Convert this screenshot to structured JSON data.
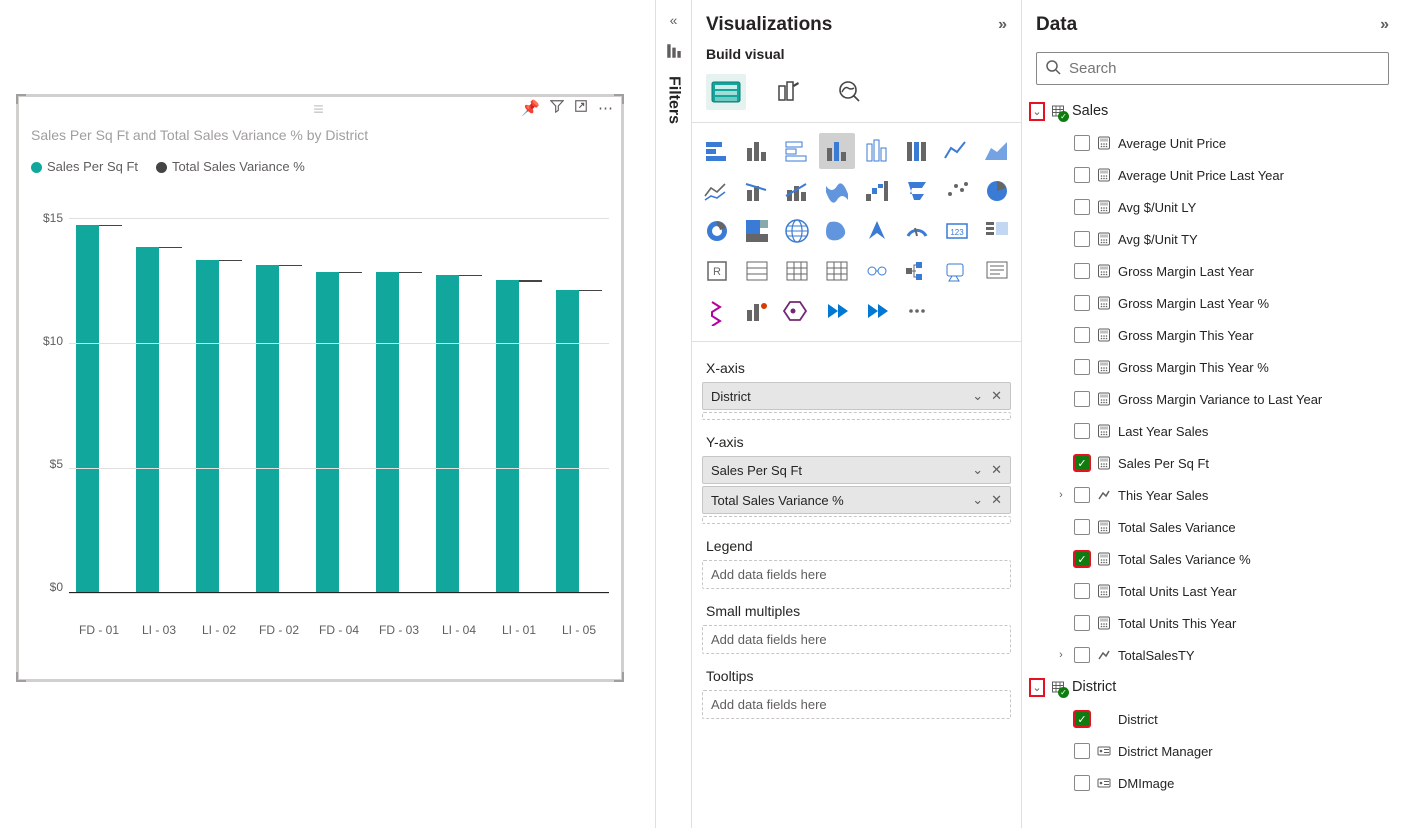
{
  "filtersRail": {
    "label": "Filters"
  },
  "visual": {
    "title": "Sales Per Sq Ft and Total Sales Variance % by District",
    "legend": [
      {
        "label": "Sales Per Sq Ft",
        "color": "#12a79d"
      },
      {
        "label": "Total Sales Variance %",
        "color": "#444444"
      }
    ],
    "toolbarIcons": [
      "pin-icon",
      "filter-icon",
      "popout-icon",
      "more-icon"
    ]
  },
  "chart_data": {
    "type": "bar",
    "title": "Sales Per Sq Ft and Total Sales Variance % by District",
    "xlabel": "",
    "ylabel": "",
    "ylim": [
      0,
      16
    ],
    "yticks": [
      0,
      5,
      10,
      15
    ],
    "yticklabels": [
      "$0",
      "$5",
      "$10",
      "$15"
    ],
    "categories": [
      "FD - 01",
      "LI - 03",
      "LI - 02",
      "FD - 02",
      "FD - 04",
      "FD - 03",
      "LI - 04",
      "LI - 01",
      "LI - 05"
    ],
    "series": [
      {
        "name": "Sales Per Sq Ft",
        "color": "#12a79d",
        "values": [
          14.7,
          13.8,
          13.3,
          13.1,
          12.8,
          12.8,
          12.7,
          12.5,
          12.1
        ]
      },
      {
        "name": "Total Sales Variance %",
        "color": "#444444",
        "values": [
          0.05,
          0.05,
          0.05,
          0.05,
          0.05,
          0.05,
          0.05,
          0.1,
          0.05
        ]
      }
    ]
  },
  "viz": {
    "header": "Visualizations",
    "sub": "Build visual",
    "wells": {
      "xaxis": {
        "label": "X-axis",
        "fields": [
          "District"
        ]
      },
      "yaxis": {
        "label": "Y-axis",
        "fields": [
          "Sales Per Sq Ft",
          "Total Sales Variance %"
        ]
      },
      "legend": {
        "label": "Legend",
        "placeholder": "Add data fields here"
      },
      "smallmult": {
        "label": "Small multiples",
        "placeholder": "Add data fields here"
      },
      "tooltips": {
        "label": "Tooltips",
        "placeholder": "Add data fields here"
      }
    }
  },
  "data": {
    "header": "Data",
    "searchPlaceholder": "Search",
    "tables": [
      {
        "name": "Sales",
        "expanded": true,
        "highlight": true,
        "fields": [
          {
            "name": "Average Unit Price",
            "icon": "calc",
            "checked": false
          },
          {
            "name": "Average Unit Price Last Year",
            "icon": "calc",
            "checked": false
          },
          {
            "name": "Avg $/Unit LY",
            "icon": "calc",
            "checked": false
          },
          {
            "name": "Avg $/Unit TY",
            "icon": "calc",
            "checked": false
          },
          {
            "name": "Gross Margin Last Year",
            "icon": "calc",
            "checked": false
          },
          {
            "name": "Gross Margin Last Year %",
            "icon": "calc",
            "checked": false
          },
          {
            "name": "Gross Margin This Year",
            "icon": "calc",
            "checked": false
          },
          {
            "name": "Gross Margin This Year %",
            "icon": "calc",
            "checked": false
          },
          {
            "name": "Gross Margin Variance to Last Year",
            "icon": "calc",
            "checked": false
          },
          {
            "name": "Last Year Sales",
            "icon": "calc",
            "checked": false
          },
          {
            "name": "Sales Per Sq Ft",
            "icon": "calc",
            "checked": true,
            "highlight": true
          },
          {
            "name": "This Year Sales",
            "icon": "hier",
            "checked": false,
            "expandable": true
          },
          {
            "name": "Total Sales Variance",
            "icon": "calc",
            "checked": false
          },
          {
            "name": "Total Sales Variance %",
            "icon": "calc",
            "checked": true,
            "highlight": true
          },
          {
            "name": "Total Units Last Year",
            "icon": "calc",
            "checked": false
          },
          {
            "name": "Total Units This Year",
            "icon": "calc",
            "checked": false
          },
          {
            "name": "TotalSalesTY",
            "icon": "hier",
            "checked": false,
            "expandable": true
          }
        ]
      },
      {
        "name": "District",
        "expanded": true,
        "highlight": true,
        "fields": [
          {
            "name": "District",
            "icon": "none",
            "checked": true,
            "highlight": true
          },
          {
            "name": "District Manager",
            "icon": "card",
            "checked": false
          },
          {
            "name": "DMImage",
            "icon": "card",
            "checked": false
          }
        ]
      }
    ]
  }
}
